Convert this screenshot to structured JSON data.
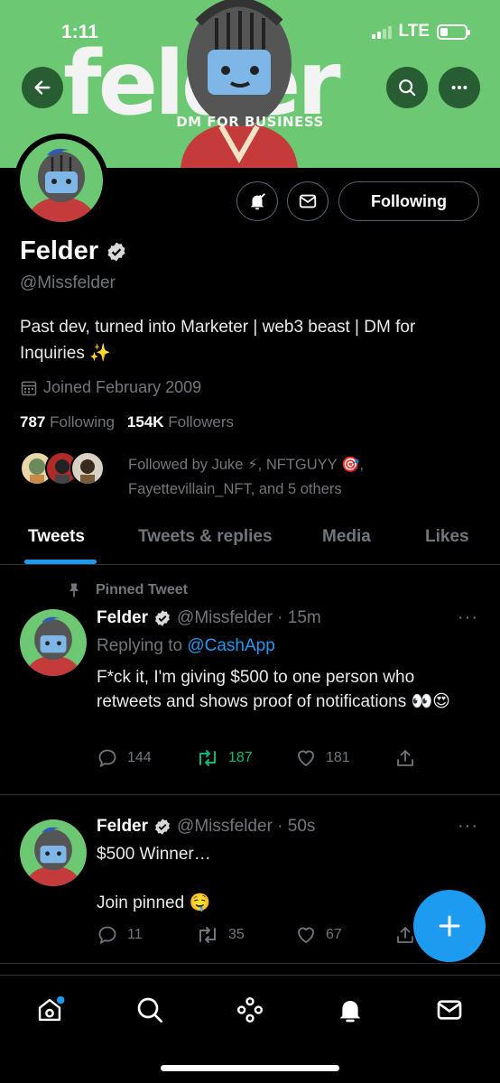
{
  "status_bar": {
    "time": "1:11",
    "network": "LTE"
  },
  "banner": {
    "wordmark": "felder",
    "subtitle": "DM FOR BUSINESS"
  },
  "header": {
    "back_icon": "back-arrow-icon",
    "search_icon": "search-icon",
    "more_icon": "more-icon"
  },
  "profile": {
    "name": "Felder",
    "handle": "@Missfelder",
    "bio": "Past dev, turned into Marketer | web3 beast | DM for Inquiries ✨",
    "joined": "Joined February 2009",
    "following_count": "787",
    "following_label": "Following",
    "followers_count": "154K",
    "followers_label": "Followers",
    "followed_by": "Followed by Juke ⚡, NFTGUYY 🎯, Fayettevillain_NFT, and 5 others",
    "following_button": "Following"
  },
  "tabs": [
    {
      "label": "Tweets",
      "active": true
    },
    {
      "label": "Tweets & replies",
      "active": false
    },
    {
      "label": "Media",
      "active": false
    },
    {
      "label": "Likes",
      "active": false
    }
  ],
  "tweets": [
    {
      "pinned_label": "Pinned Tweet",
      "name": "Felder",
      "handle_time": "@Missfelder · 15m",
      "reply_prefix": "Replying to",
      "reply_to": "@CashApp",
      "text": "F*ck it, I'm giving $500 to one person who retweets and shows proof of notifications 👀😍",
      "replies": "144",
      "retweets": "187",
      "likes": "181"
    },
    {
      "name": "Felder",
      "handle_time": "@Missfelder · 50s",
      "text_line1": "$500 Winner…",
      "text_line2": "Join pinned 🤤",
      "replies": "11",
      "retweets": "35",
      "likes": "67"
    }
  ],
  "colors": {
    "accent": "#1d9bf0",
    "banner_green": "#6cc872",
    "retweet_green": "#00ba7c",
    "muted": "#71767b"
  },
  "bottom_nav": [
    "home-icon",
    "search-icon",
    "spaces-icon",
    "notifications-icon",
    "messages-icon"
  ]
}
